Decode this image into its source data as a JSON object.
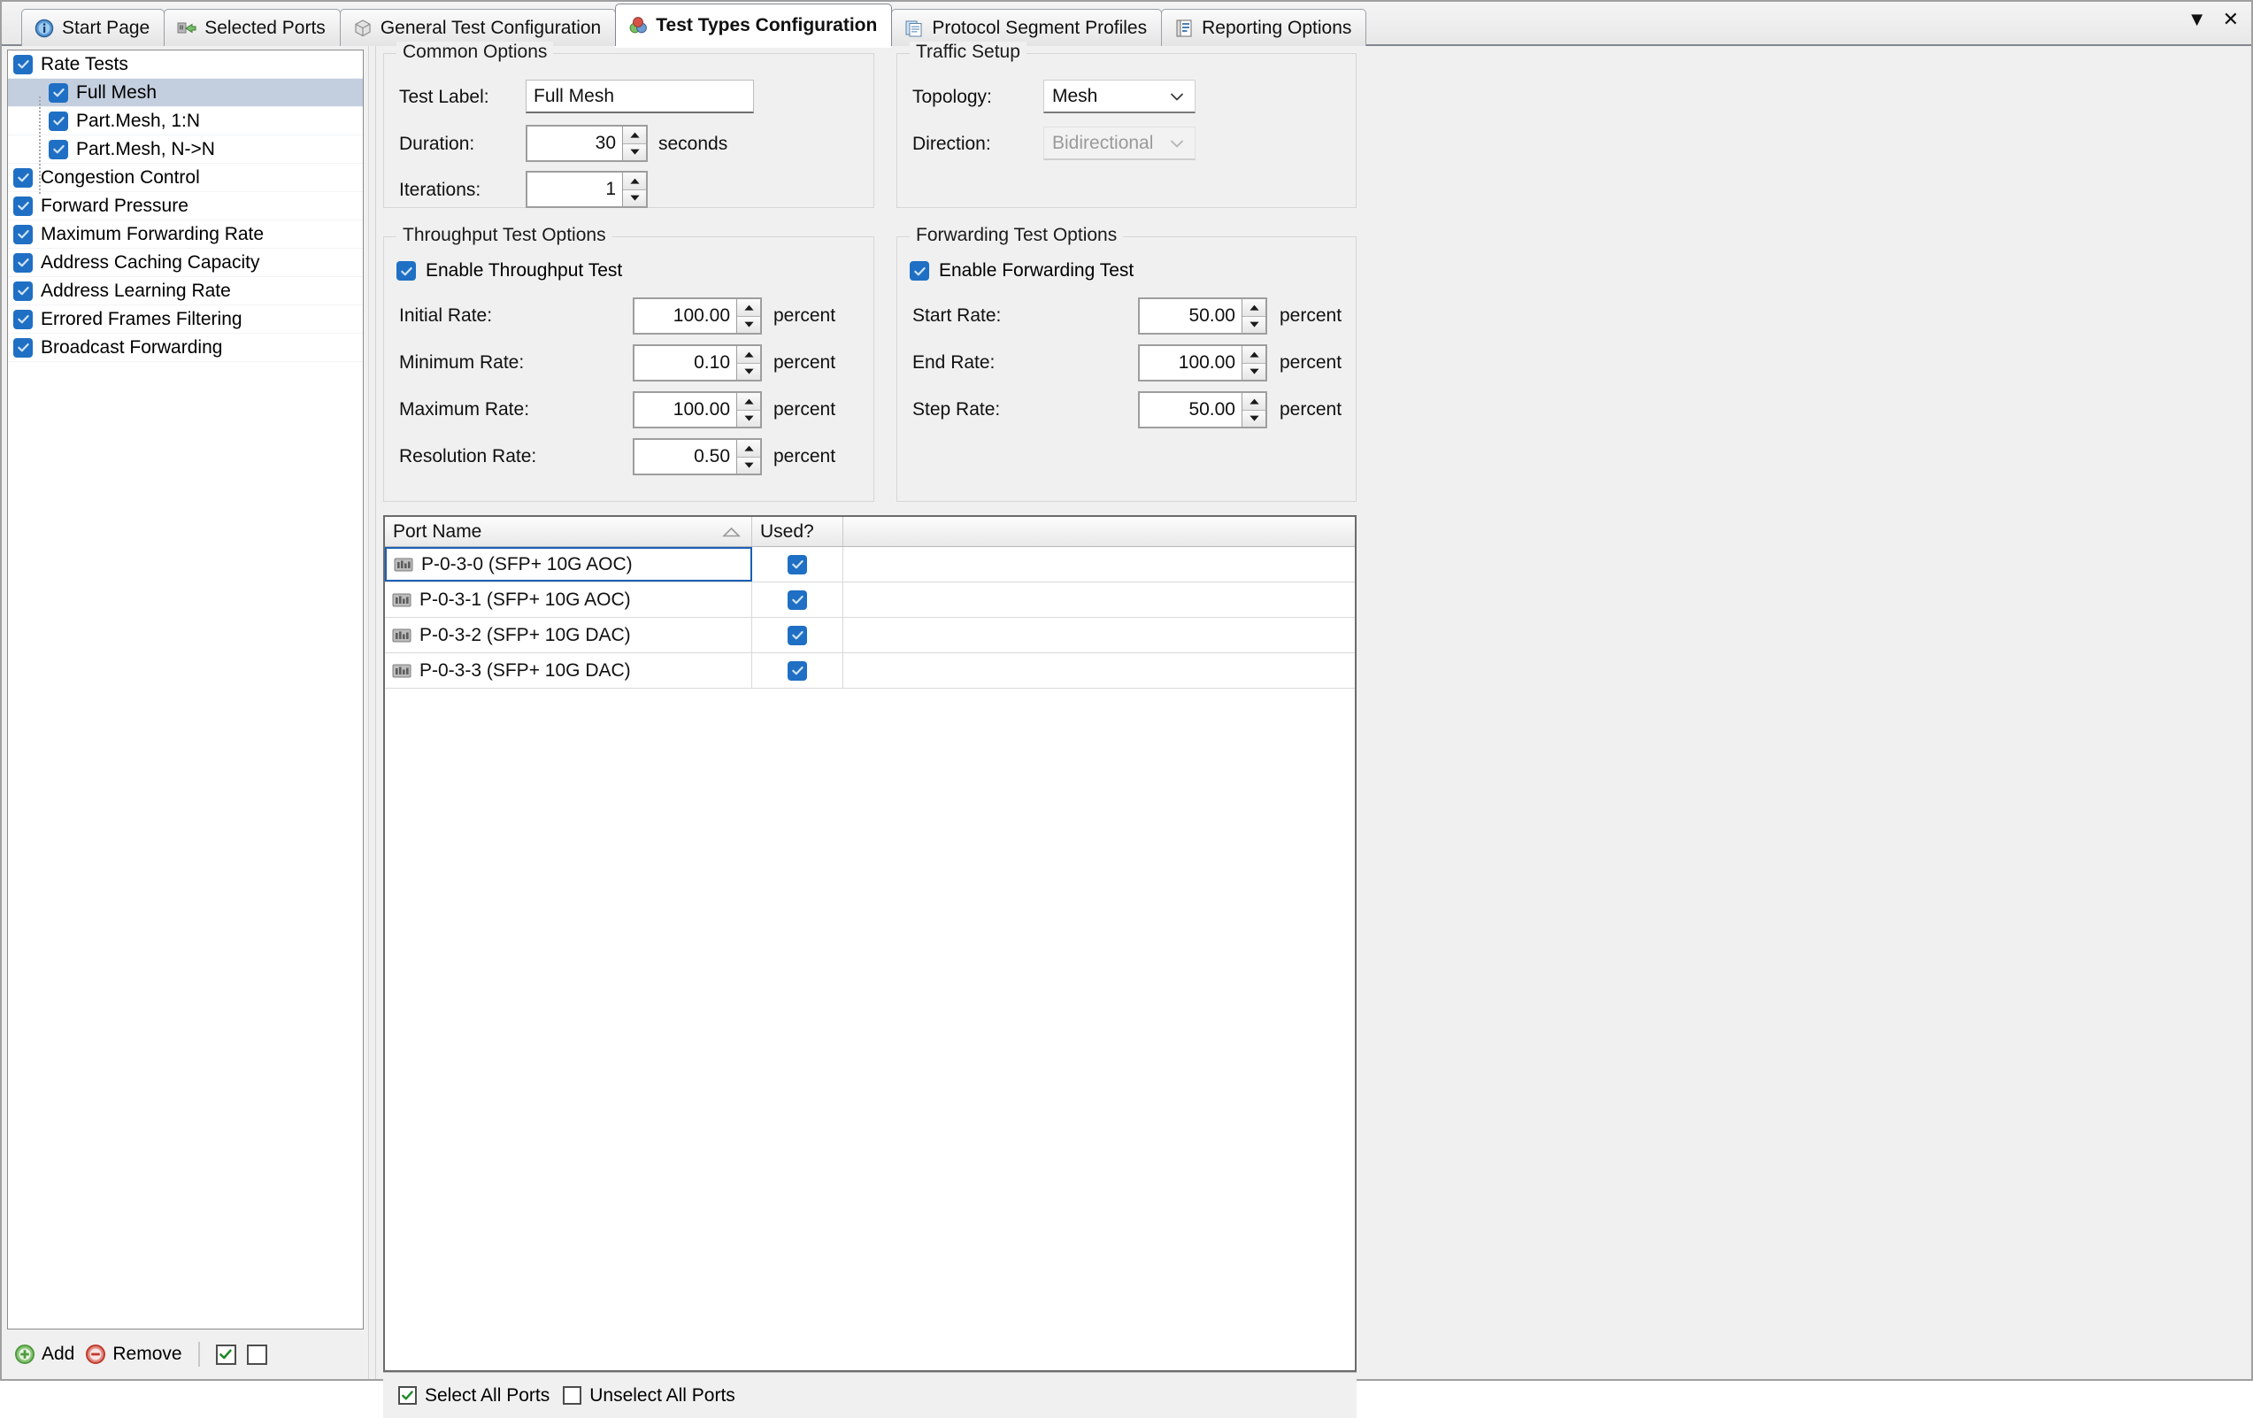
{
  "window": {
    "tabs": [
      {
        "label": "Start Page",
        "icon": "info-icon",
        "active": false
      },
      {
        "label": "Selected Ports",
        "icon": "ports-icon",
        "active": false
      },
      {
        "label": "General Test Configuration",
        "icon": "cube-icon",
        "active": false
      },
      {
        "label": "Test Types Configuration",
        "icon": "spheres-icon",
        "active": true
      },
      {
        "label": "Protocol Segment Profiles",
        "icon": "pages-icon",
        "active": false
      },
      {
        "label": "Reporting Options",
        "icon": "notebook-icon",
        "active": false
      }
    ],
    "controls": {
      "dropdown": "▼",
      "close": "✕"
    }
  },
  "tree": {
    "items": [
      {
        "label": "Rate Tests",
        "checked": true,
        "child": false,
        "selected": false
      },
      {
        "label": "Full Mesh",
        "checked": true,
        "child": true,
        "selected": true
      },
      {
        "label": "Part.Mesh, 1:N",
        "checked": true,
        "child": true,
        "selected": false
      },
      {
        "label": "Part.Mesh, N->N",
        "checked": true,
        "child": true,
        "selected": false
      },
      {
        "label": "Congestion Control",
        "checked": true,
        "child": false,
        "selected": false
      },
      {
        "label": "Forward Pressure",
        "checked": true,
        "child": false,
        "selected": false
      },
      {
        "label": "Maximum Forwarding Rate",
        "checked": true,
        "child": false,
        "selected": false
      },
      {
        "label": "Address Caching Capacity",
        "checked": true,
        "child": false,
        "selected": false
      },
      {
        "label": "Address Learning Rate",
        "checked": true,
        "child": false,
        "selected": false
      },
      {
        "label": "Errored Frames Filtering",
        "checked": true,
        "child": false,
        "selected": false
      },
      {
        "label": "Broadcast Forwarding",
        "checked": true,
        "child": false,
        "selected": false
      }
    ],
    "toolbar": {
      "add_label": "Add",
      "remove_label": "Remove",
      "check_all_checked": true,
      "uncheck_all_checked": false
    }
  },
  "common_options": {
    "title": "Common Options",
    "test_label_label": "Test Label:",
    "test_label_value": "Full Mesh",
    "duration_label": "Duration:",
    "duration_value": "30",
    "duration_unit": "seconds",
    "iterations_label": "Iterations:",
    "iterations_value": "1"
  },
  "traffic_setup": {
    "title": "Traffic Setup",
    "topology_label": "Topology:",
    "topology_value": "Mesh",
    "direction_label": "Direction:",
    "direction_value": "Bidirectional",
    "direction_disabled": true
  },
  "throughput": {
    "title": "Throughput Test Options",
    "enable_label": "Enable Throughput Test",
    "enabled": true,
    "rows": [
      {
        "label": "Initial Rate:",
        "value": "100.00",
        "unit": "percent"
      },
      {
        "label": "Minimum Rate:",
        "value": "0.10",
        "unit": "percent"
      },
      {
        "label": "Maximum Rate:",
        "value": "100.00",
        "unit": "percent"
      },
      {
        "label": "Resolution Rate:",
        "value": "0.50",
        "unit": "percent"
      }
    ]
  },
  "forwarding": {
    "title": "Forwarding Test Options",
    "enable_label": "Enable Forwarding Test",
    "enabled": true,
    "rows": [
      {
        "label": "Start Rate:",
        "value": "50.00",
        "unit": "percent"
      },
      {
        "label": "End Rate:",
        "value": "100.00",
        "unit": "percent"
      },
      {
        "label": "Step Rate:",
        "value": "50.00",
        "unit": "percent"
      }
    ]
  },
  "port_table": {
    "columns": [
      "Port Name",
      "Used?"
    ],
    "sort_column": "Port Name",
    "sort_direction": "ascending",
    "rows": [
      {
        "name": "P-0-3-0 (SFP+ 10G AOC)",
        "used": true,
        "selected": true
      },
      {
        "name": "P-0-3-1 (SFP+ 10G AOC)",
        "used": true,
        "selected": false
      },
      {
        "name": "P-0-3-2 (SFP+ 10G DAC)",
        "used": true,
        "selected": false
      },
      {
        "name": "P-0-3-3 (SFP+ 10G DAC)",
        "used": true,
        "selected": false
      }
    ],
    "footer": {
      "select_all_label": "Select All Ports",
      "select_all_checked": true,
      "unselect_all_label": "Unselect All Ports",
      "unselect_all_checked": false
    }
  },
  "colors": {
    "accent": "#1f6fc4",
    "selection": "#c3cede",
    "focus_border": "#1a5fb4",
    "add_green": "#4f9a3e",
    "remove_red": "#c0392b"
  }
}
